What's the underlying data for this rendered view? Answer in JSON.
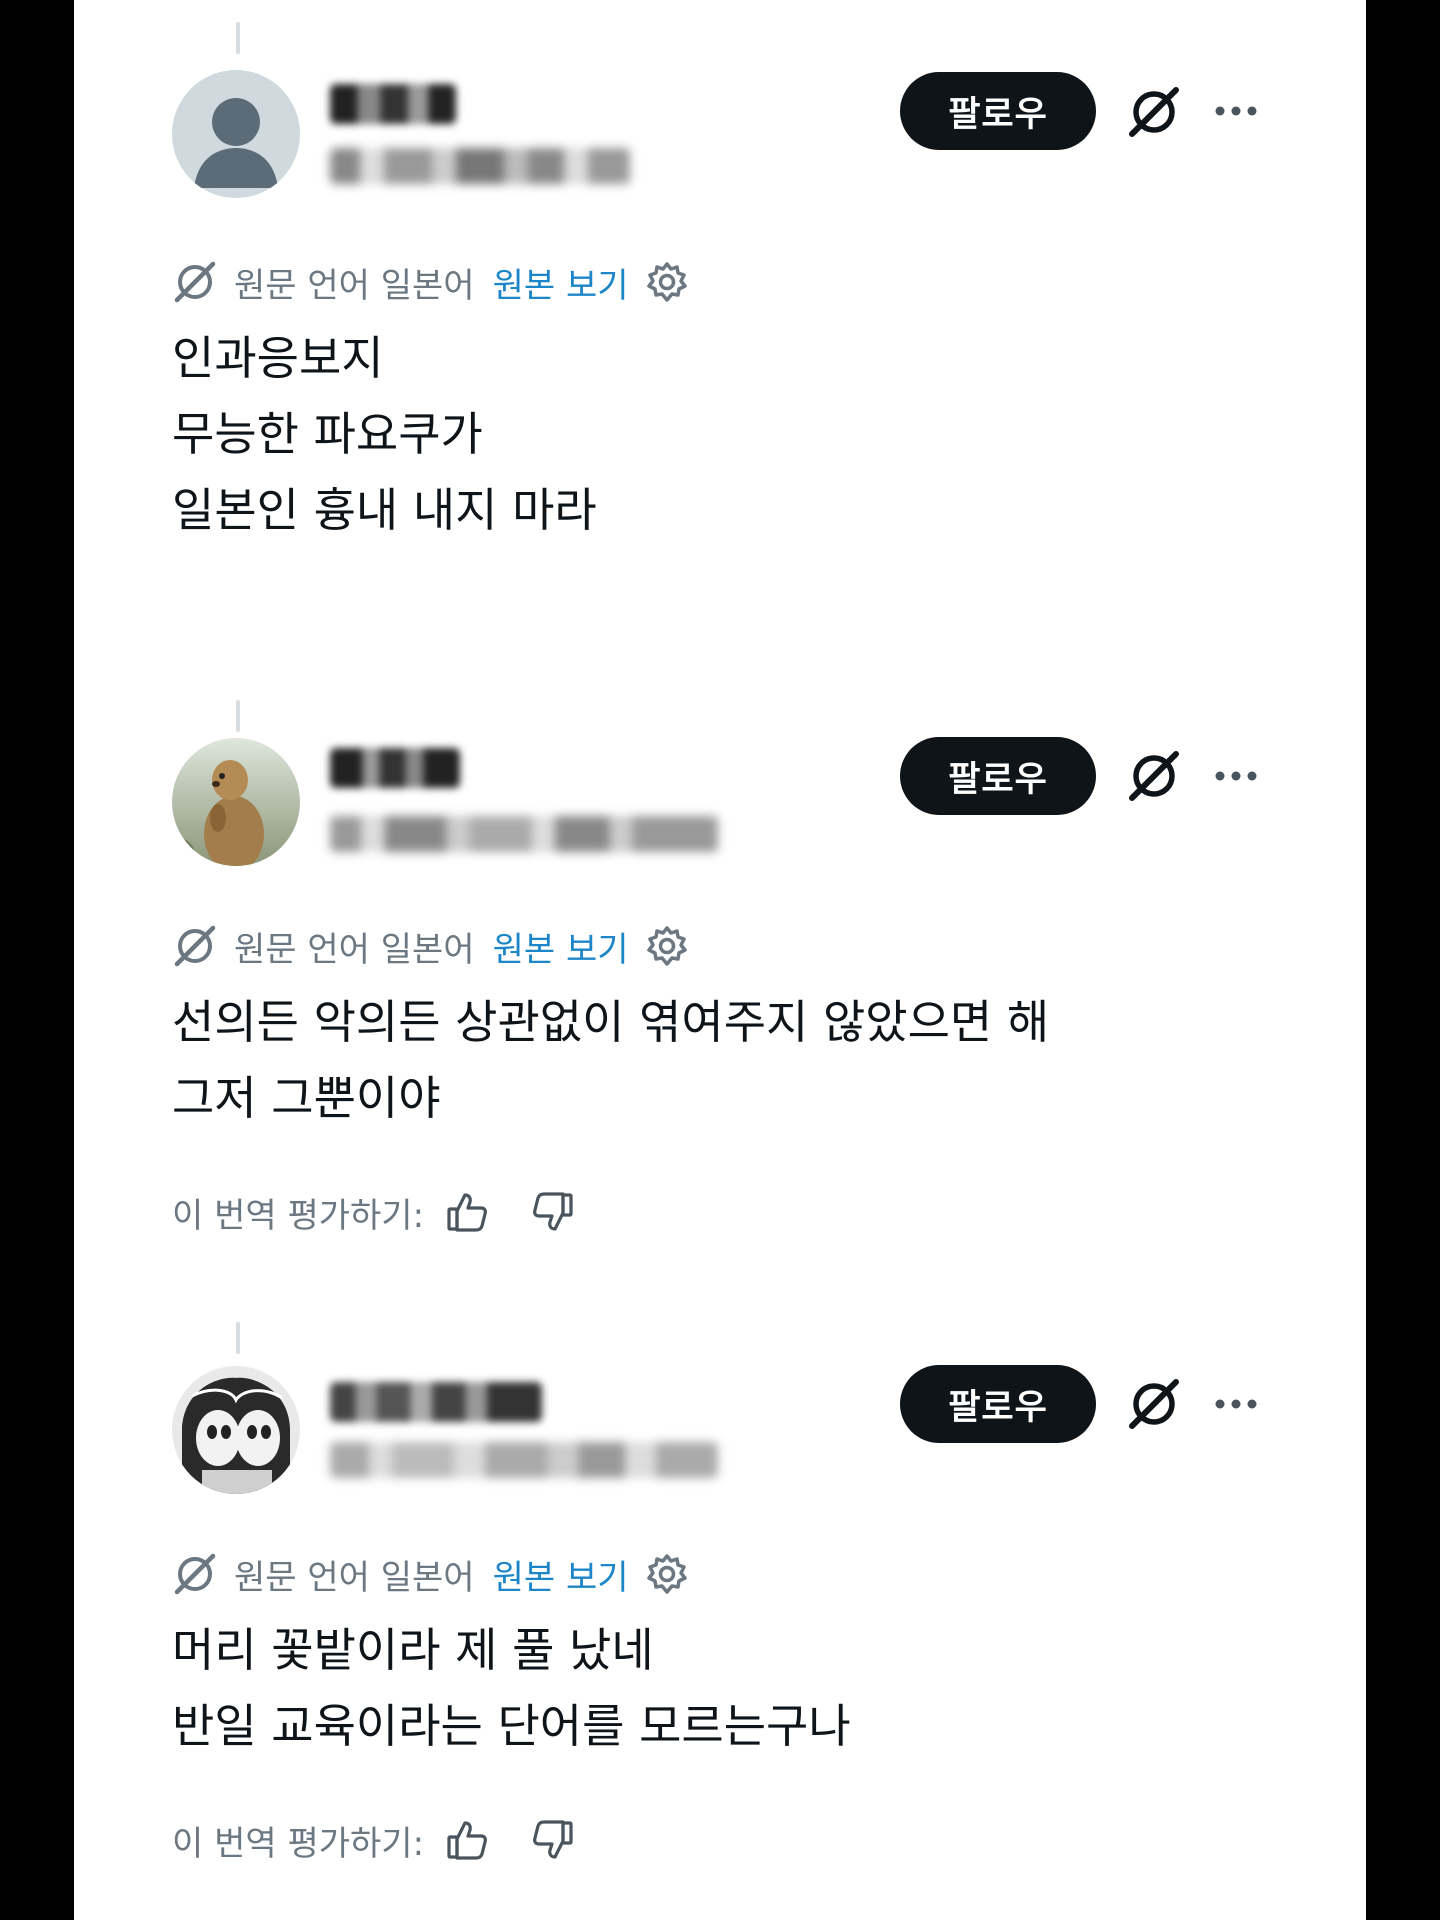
{
  "posts": [
    {
      "follow_label": "팔로우",
      "translate": {
        "source_label": "원문 언어 일본어",
        "view_original": "원본 보기"
      },
      "lines": [
        "인과응보지",
        "무능한 파요쿠가",
        "일본인 흉내 내지 마라"
      ],
      "rating": null
    },
    {
      "follow_label": "팔로우",
      "translate": {
        "source_label": "원문 언어 일본어",
        "view_original": "원본 보기"
      },
      "lines": [
        "선의든 악의든 상관없이 엮여주지 않았으면 해",
        "그저 그뿐이야"
      ],
      "rating": {
        "label": "이 번역 평가하기:"
      }
    },
    {
      "follow_label": "팔로우",
      "translate": {
        "source_label": "원문 언어 일본어",
        "view_original": "원본 보기"
      },
      "lines": [
        "머리 꽃밭이라 제 풀 났네",
        "반일 교육이라는 단어를 모르는구나"
      ],
      "rating": {
        "label": "이 번역 평가하기:"
      }
    }
  ],
  "icons": {
    "grok": "grok-icon",
    "more": "more-icon",
    "gear": "gear-icon",
    "thumbs_up": "thumbs-up-icon",
    "thumbs_down": "thumbs-down-icon"
  },
  "colors": {
    "button_bg": "#0f1419",
    "link": "#1d86c8",
    "muted": "#6b7781",
    "text": "#0f1419"
  }
}
